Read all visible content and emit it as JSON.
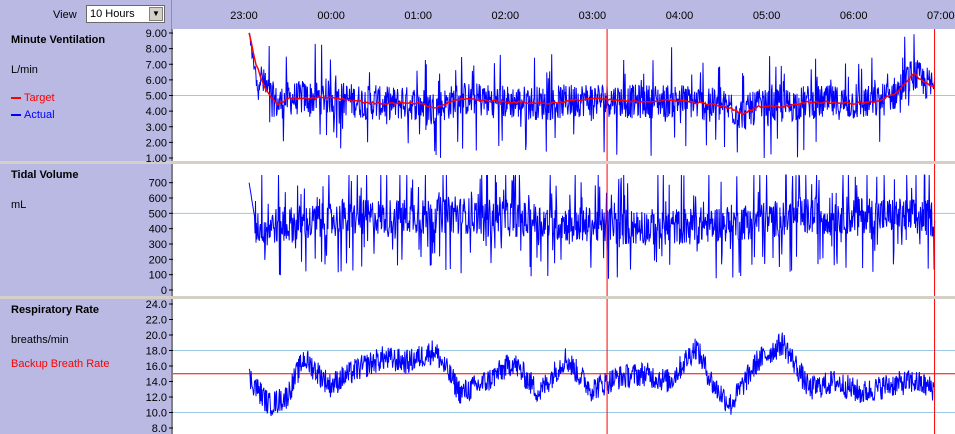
{
  "toolbar": {
    "view_label": "View",
    "view_value": "10 Hours"
  },
  "time_axis": {
    "ticks": [
      {
        "label": "23:00",
        "hour": -1
      },
      {
        "label": "00:00",
        "hour": 0
      },
      {
        "label": "01:00",
        "hour": 1
      },
      {
        "label": "02:00",
        "hour": 2
      },
      {
        "label": "03:00",
        "hour": 3
      },
      {
        "label": "04:00",
        "hour": 4
      },
      {
        "label": "05:00",
        "hour": 5
      },
      {
        "label": "06:00",
        "hour": 6
      },
      {
        "label": "07:00",
        "hour": 7
      }
    ],
    "cursor_hour": 3.18,
    "end_hour": 6.94,
    "data_start_hour": -0.93
  },
  "colors": {
    "actual": "#0000ff",
    "target": "#ff0000",
    "backup": "#ff0000",
    "cursor": "#ff0000",
    "grid": "#9ec7e6",
    "panel": "#b9b9e3"
  },
  "chart_data": [
    {
      "type": "line",
      "title": "Minute Ventilation",
      "ylabel": "L/min",
      "ylim": [
        1.0,
        9.0
      ],
      "yticks": [
        "9.00",
        "8.00",
        "7.00",
        "6.00",
        "5.00",
        "4.00",
        "3.00",
        "2.00",
        "1.00"
      ],
      "gridline": 5.0,
      "series": [
        {
          "name": "Target",
          "color": "#ff0000",
          "x": [
            -0.93,
            -0.85,
            -0.75,
            -0.6,
            -0.5,
            0,
            0.5,
            1,
            1.2,
            1.5,
            2,
            2.5,
            3,
            3.5,
            4,
            4.4,
            4.6,
            4.75,
            4.9,
            5.2,
            5.5,
            6,
            6.3,
            6.5,
            6.7,
            6.8,
            6.94
          ],
          "y": [
            9.0,
            7.0,
            5.5,
            4.4,
            4.8,
            4.9,
            4.5,
            4.5,
            4.2,
            4.8,
            4.6,
            4.5,
            4.8,
            4.6,
            4.7,
            4.4,
            4.2,
            3.8,
            4.3,
            4.3,
            4.6,
            4.5,
            4.6,
            5.2,
            6.4,
            5.9,
            5.5
          ]
        },
        {
          "name": "Actual",
          "color": "#0000ff",
          "x": [
            -0.93,
            6.94
          ],
          "y": [
            4.6,
            5.4
          ]
        }
      ]
    },
    {
      "type": "line",
      "title": "Tidal Volume",
      "ylabel": "mL",
      "ylim": [
        0,
        750
      ],
      "yticks": [
        "700",
        "600",
        "500",
        "400",
        "300",
        "200",
        "100",
        "0"
      ],
      "gridline": 500,
      "series": [
        {
          "name": "",
          "color": "#0000ff",
          "x": [
            -0.93,
            6.94
          ],
          "y": [
            450,
            420
          ]
        }
      ]
    },
    {
      "type": "line",
      "title": "Respiratory Rate",
      "ylabel": "breaths/min",
      "ylim": [
        8.0,
        24.0
      ],
      "yticks": [
        "24.0",
        "22.0",
        "20.0",
        "18.0",
        "16.0",
        "14.0",
        "12.0",
        "10.0",
        "8.0"
      ],
      "gridlines": [
        18.0,
        10.0
      ],
      "backup_label": "Backup Breath Rate",
      "backup_rate": 15.0,
      "series": [
        {
          "name": "",
          "color": "#0000ff",
          "x": [
            -0.93,
            -0.8,
            -0.7,
            -0.5,
            -0.3,
            0,
            0.3,
            0.6,
            0.9,
            1.2,
            1.5,
            1.8,
            2.1,
            2.4,
            2.7,
            3.0,
            3.3,
            3.6,
            3.9,
            4.2,
            4.4,
            4.6,
            4.9,
            5.2,
            5.5,
            5.8,
            6.1,
            6.4,
            6.7,
            6.94
          ],
          "y": [
            14.5,
            12.5,
            11.0,
            12.0,
            17.0,
            13.5,
            15.5,
            17.0,
            16.5,
            18.0,
            12.5,
            14.0,
            16.5,
            12.5,
            17.0,
            13.0,
            14.5,
            15.0,
            14.0,
            18.5,
            13.5,
            11.0,
            16.5,
            19.0,
            13.0,
            14.0,
            12.5,
            13.5,
            14.0,
            13.0
          ]
        }
      ]
    }
  ]
}
